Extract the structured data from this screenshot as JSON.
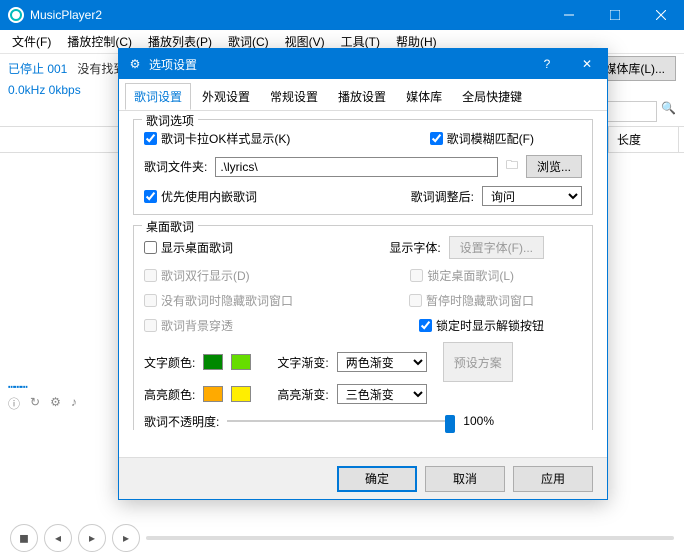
{
  "app": {
    "title": "MusicPlayer2"
  },
  "menu": [
    "文件(F)",
    "播放控制(C)",
    "播放列表(P)",
    "歌词(C)",
    "视图(V)",
    "工具(T)",
    "帮助(H)"
  ],
  "status": {
    "stopped": "已停止 001",
    "nofile": "没有找到文件",
    "kbps": "0.0kHz 0kbps"
  },
  "libbtn": "媒体库(L)...",
  "table": {
    "col_album": "辑",
    "col_len": "长度"
  },
  "dialog": {
    "title": "选项设置",
    "tabs": [
      "歌词设置",
      "外观设置",
      "常规设置",
      "播放设置",
      "媒体库",
      "全局快捷键"
    ],
    "group1": {
      "legend": "歌词选项",
      "karaoke": "歌词卡拉OK样式显示(K)",
      "fuzzy": "歌词模糊匹配(F)",
      "folder_label": "歌词文件夹:",
      "folder_value": ".\\lyrics\\",
      "browse": "浏览...",
      "embed": "优先使用内嵌歌词",
      "adjust_label": "歌词调整后:",
      "adjust_value": "询问"
    },
    "group2": {
      "legend": "桌面歌词",
      "show": "显示桌面歌词",
      "font_label": "显示字体:",
      "font_btn": "设置字体(F)...",
      "twoline": "歌词双行显示(D)",
      "lock": "锁定桌面歌词(L)",
      "hide_none": "没有歌词时隐藏歌词窗口",
      "hide_pause": "暂停时隐藏歌词窗口",
      "bgtrans": "歌词背景穿透",
      "showlock": "锁定时显示解锁按钮",
      "text_color": "文字颜色:",
      "text_grad": "文字渐变:",
      "text_grad_val": "两色渐变",
      "hilite_color": "高亮颜色:",
      "hilite_grad": "高亮渐变:",
      "hilite_grad_val": "三色渐变",
      "preset": "预设方案",
      "opacity_label": "歌词不透明度:",
      "opacity_val": "100%"
    },
    "buttons": {
      "ok": "确定",
      "cancel": "取消",
      "apply": "应用"
    }
  },
  "colors": {
    "text1": "#008800",
    "text2": "#66dd00",
    "hilite1": "#ffaa00",
    "hilite2": "#ffee00"
  }
}
